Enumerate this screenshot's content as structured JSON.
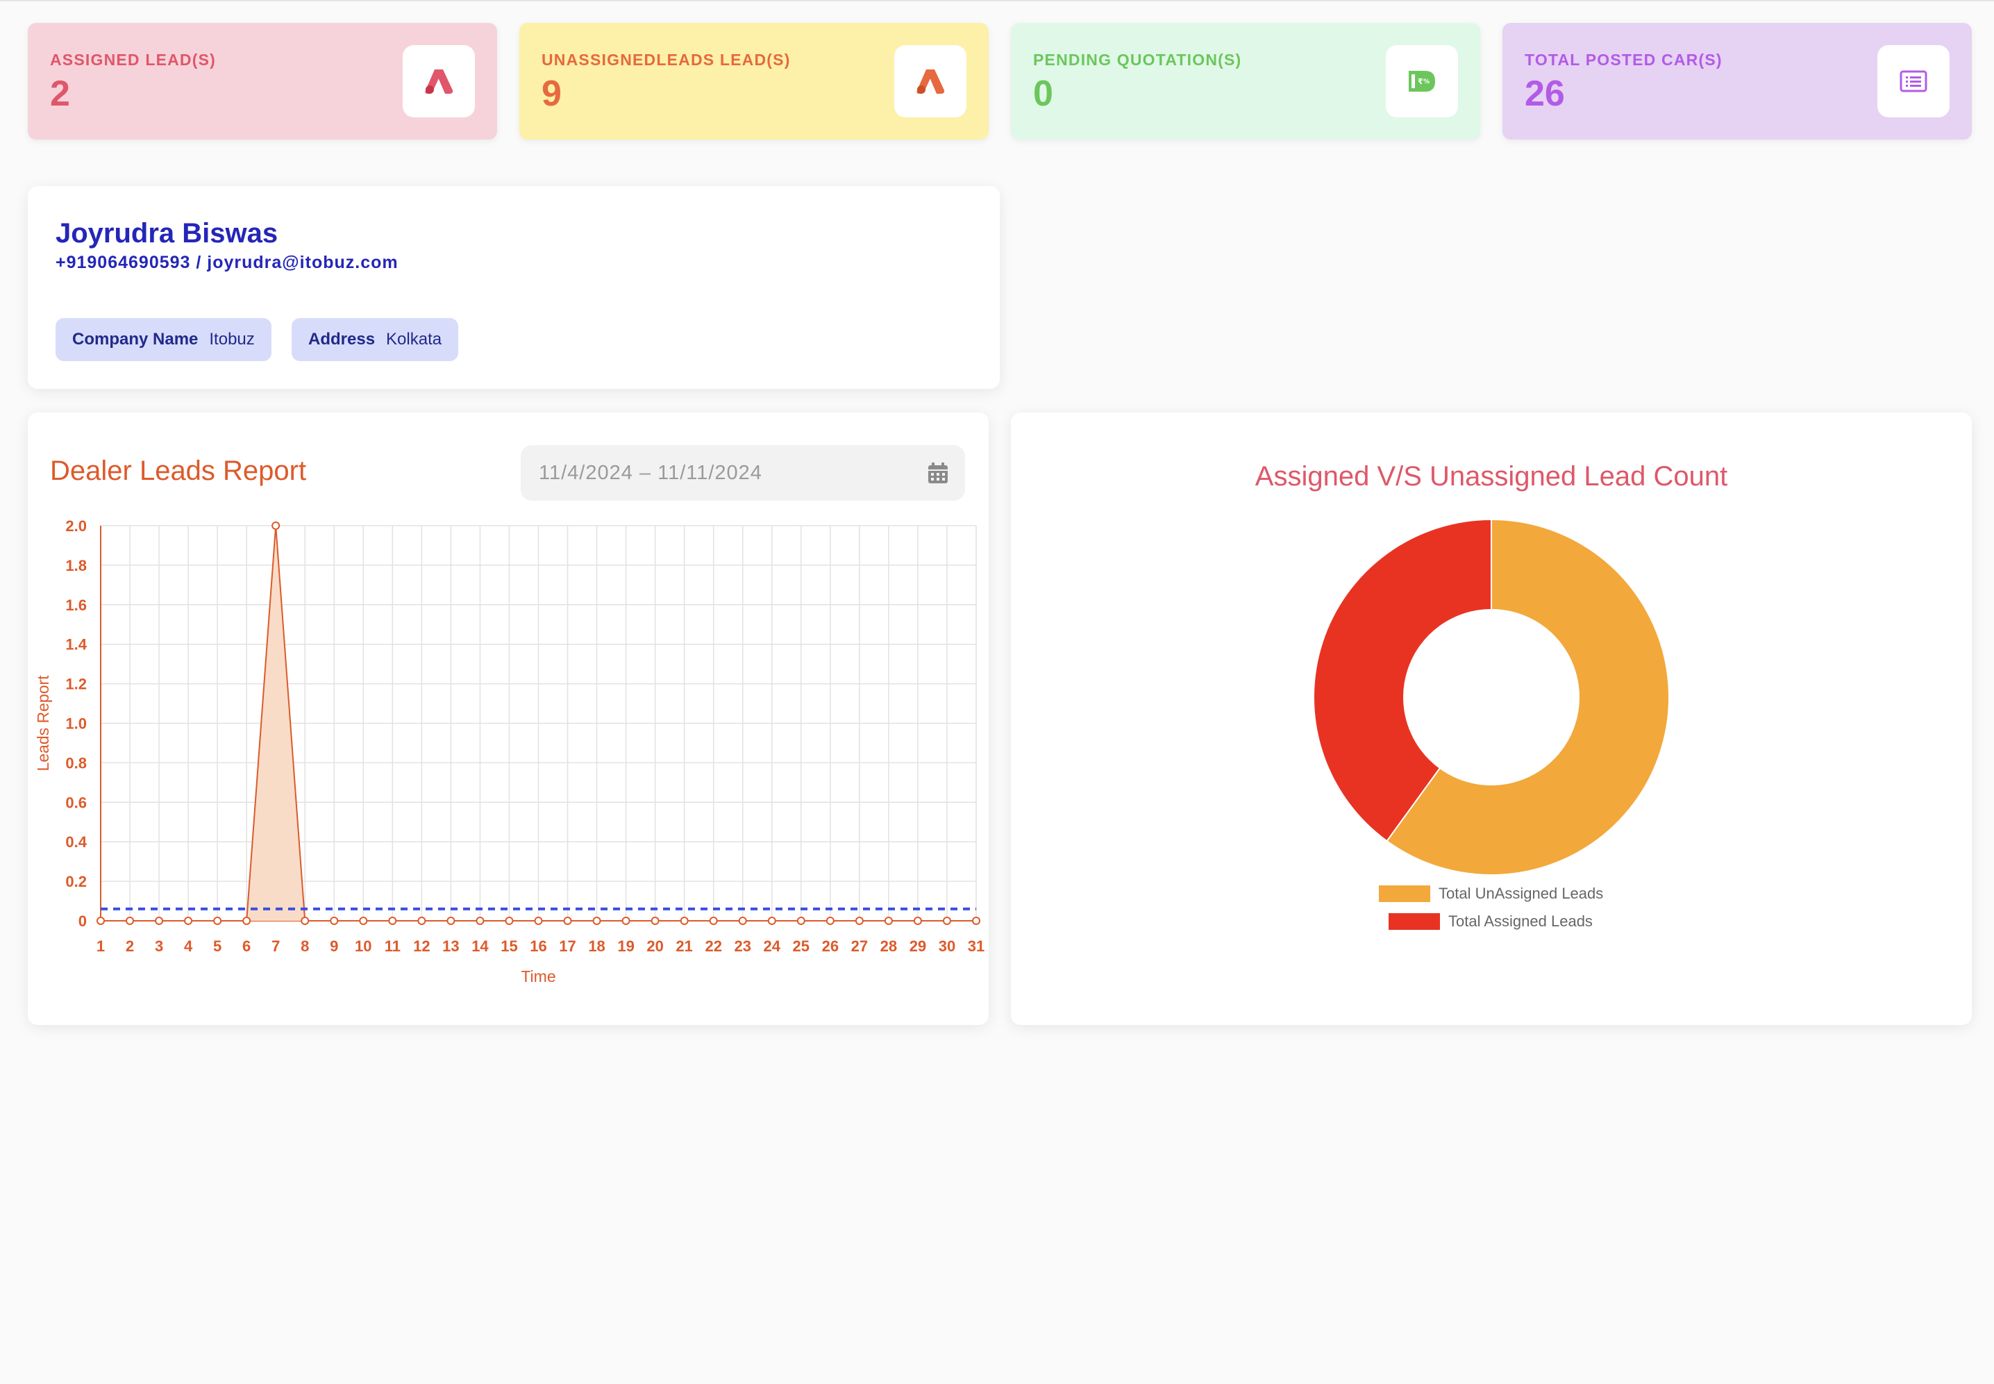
{
  "stats": [
    {
      "label": "ASSIGNED LEAD(S)",
      "value": "2",
      "icon": "lead-a-icon",
      "bg": "#f6d3da",
      "color": "#e0566a"
    },
    {
      "label": "UNASSIGNEDLEADS LEAD(S)",
      "value": "9",
      "icon": "lead-a-icon",
      "bg": "#fdf0a8",
      "color": "#e6693f"
    },
    {
      "label": "PENDING QUOTATION(S)",
      "value": "0",
      "icon": "price-tag-icon",
      "bg": "#e0f8e8",
      "color": "#6cc65c"
    },
    {
      "label": "TOTAL POSTED CAR(S)",
      "value": "26",
      "icon": "list-icon",
      "bg": "#e6d2f3",
      "color": "#b25be6"
    }
  ],
  "profile": {
    "name": "Joyrudra Biswas",
    "contact": "+919064690593 / joyrudra@itobuz.com",
    "company_label": "Company Name",
    "company_value": "Itobuz",
    "address_label": "Address",
    "address_value": "Kolkata"
  },
  "line_card": {
    "title": "Dealer Leads Report",
    "date_range": "11/4/2024 – 11/11/2024",
    "calendar_icon": "calendar-icon"
  },
  "pie_card": {
    "title": "Assigned V/S Unassigned Lead Count"
  },
  "chart_data": [
    {
      "type": "area",
      "xlabel": "Time",
      "ylabel": "Leads Report",
      "x": [
        1,
        2,
        3,
        4,
        5,
        6,
        7,
        8,
        9,
        10,
        11,
        12,
        13,
        14,
        15,
        16,
        17,
        18,
        19,
        20,
        21,
        22,
        23,
        24,
        25,
        26,
        27,
        28,
        29,
        30,
        31
      ],
      "series": [
        {
          "values": [
            0,
            0,
            0,
            0,
            0,
            0,
            2,
            0,
            0,
            0,
            0,
            0,
            0,
            0,
            0,
            0,
            0,
            0,
            0,
            0,
            0,
            0,
            0,
            0,
            0,
            0,
            0,
            0,
            0,
            0,
            0
          ],
          "color": "#dd5a2a",
          "fill": "#f8dcc8"
        },
        {
          "values": [
            0.06,
            0.06,
            0.06,
            0.06,
            0.06,
            0.06,
            0.06,
            0.06,
            0.06,
            0.06,
            0.06,
            0.06,
            0.06,
            0.06,
            0.06,
            0.06,
            0.06,
            0.06,
            0.06,
            0.06,
            0.06,
            0.06,
            0.06,
            0.06,
            0.06,
            0.06,
            0.06,
            0.06,
            0.06,
            0.06,
            0.06
          ],
          "color": "#3b4fe0",
          "style": "dashed"
        }
      ],
      "ylim": [
        0,
        2
      ],
      "yticks": [
        "0",
        "0.2",
        "0.4",
        "0.6",
        "0.8",
        "1.0",
        "1.2",
        "1.4",
        "1.6",
        "1.8",
        "2.0"
      ],
      "grid": true
    },
    {
      "type": "pie",
      "donut": true,
      "labels": [
        "Total UnAssigned Leads",
        "Total Assigned Leads"
      ],
      "values": [
        9,
        6
      ],
      "colors": [
        "#f2a83b",
        "#e83323"
      ],
      "legend": "bottom"
    }
  ]
}
